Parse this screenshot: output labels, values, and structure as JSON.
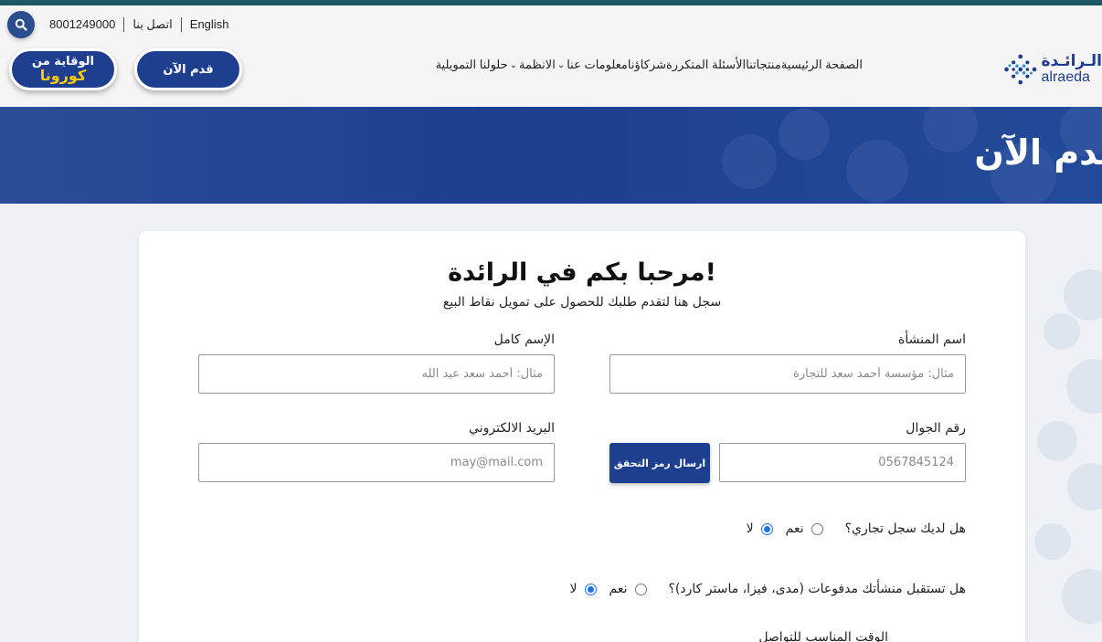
{
  "utility_bar": {
    "phone": "8001249000",
    "contact": "اتصل بنا",
    "language": "English"
  },
  "buttons": {
    "apply_now": "قدم الآن",
    "corona_line1": "الوقاية من",
    "corona_line2": "كورونا"
  },
  "nav": {
    "items": [
      {
        "label": "الصفحة الرئيسية",
        "dropdown": false
      },
      {
        "label": "منتجاتنا",
        "dropdown": false
      },
      {
        "label": "الأسئلة المتكررة",
        "dropdown": false
      },
      {
        "label": "شركاؤنا",
        "dropdown": false
      },
      {
        "label": "معلومات عنا",
        "dropdown": true
      },
      {
        "label": "الانظمة",
        "dropdown": true
      },
      {
        "label": "حلولنا التمويلية",
        "dropdown": false
      }
    ]
  },
  "logo": {
    "arabic": "الـرائـدة",
    "english": "alraeda"
  },
  "banner": {
    "title": "قدم الآن"
  },
  "form": {
    "title": "مرحبا بكم في الرائدة!",
    "subtitle": "سجل هنا لتقدم طلبك للحصول على تمويل نقاط البيع",
    "establishment_label": "اسم المنشأة",
    "establishment_placeholder": "مثال: مؤسسة أحمد سعد للتجارة",
    "fullname_label": "الإسم كامل",
    "fullname_placeholder": "مثال: أحمد سعد عبد الله",
    "mobile_label": "رقم الجوال",
    "mobile_placeholder": "0567845124",
    "verify_button": "ارسال رمز التحقق",
    "email_label": "البريد الالكتروني",
    "email_placeholder": "may@mail.com",
    "q1": "هل لديك سجل تجاري؟",
    "q2": "هل تستقبل منشأتك مدفوعات (مدى، فيزا، ماستر كارد)؟",
    "yes": "نعم",
    "no": "لا",
    "q1_selected": "no",
    "q2_selected": "no",
    "cut_label": "الوقت المناسب للتواصل"
  },
  "colors": {
    "primary": "#1e3f8f",
    "accent": "#ffcc00",
    "top_strip": "#1e5a66",
    "radio": "#1a73e8"
  }
}
